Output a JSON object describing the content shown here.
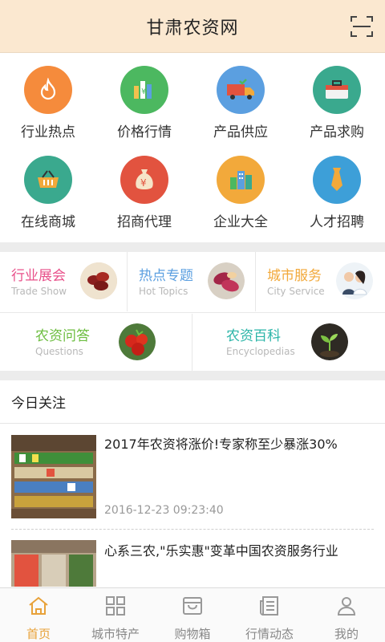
{
  "header": {
    "title": "甘肃农资网",
    "scan_icon": "scan-icon"
  },
  "grid": [
    {
      "label": "行业热点",
      "color": "#f58b3c",
      "icon": "flame-icon"
    },
    {
      "label": "价格行情",
      "color": "#4cb860",
      "icon": "price-chart-icon"
    },
    {
      "label": "产品供应",
      "color": "#5b9fe0",
      "icon": "delivery-truck-icon"
    },
    {
      "label": "产品求购",
      "color": "#3aa98e",
      "icon": "briefcase-icon"
    },
    {
      "label": "在线商城",
      "color": "#3aa98e",
      "icon": "shopping-basket-icon"
    },
    {
      "label": "招商代理",
      "color": "#e2533f",
      "icon": "money-bag-icon"
    },
    {
      "label": "企业大全",
      "color": "#f2a93b",
      "icon": "buildings-icon"
    },
    {
      "label": "人才招聘",
      "color": "#3d9fd8",
      "icon": "necktie-icon"
    }
  ],
  "promos": {
    "trade_show": {
      "cn": "行业展会",
      "en": "Trade Show",
      "color": "#e8508a"
    },
    "hot_topics": {
      "cn": "热点专题",
      "en": "Hot Topics",
      "color": "#5b9fe0"
    },
    "city_service": {
      "cn": "城市服务",
      "en": "City Service",
      "color": "#f2a93b"
    },
    "questions": {
      "cn": "农资问答",
      "en": "Questions",
      "color": "#6cbd3f"
    },
    "encyclopedias": {
      "cn": "农资百科",
      "en": "Encyclopedias",
      "color": "#2bb5a8"
    }
  },
  "today": {
    "title": "今日关注",
    "news": [
      {
        "title": "2017年农资将涨价!专家称至少暴涨30%",
        "time": "2016-12-23 09:23:40"
      },
      {
        "title": "心系三农,\"乐实惠\"变革中国农资服务行业",
        "time": ""
      }
    ]
  },
  "tabs": [
    {
      "label": "首页",
      "icon": "home-icon",
      "active": true
    },
    {
      "label": "城市特产",
      "icon": "grid-icon",
      "active": false
    },
    {
      "label": "购物箱",
      "icon": "box-icon",
      "active": false
    },
    {
      "label": "行情动态",
      "icon": "news-icon",
      "active": false
    },
    {
      "label": "我的",
      "icon": "user-icon",
      "active": false
    }
  ],
  "accent_color": "#e8a23a"
}
